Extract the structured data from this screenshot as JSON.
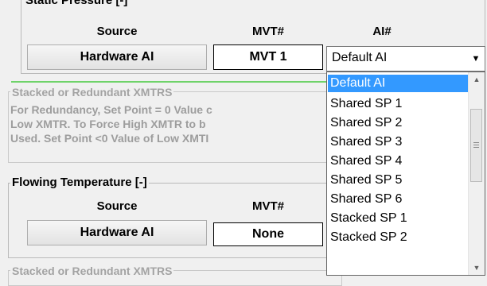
{
  "static_pressure": {
    "group_label": "Static Pressure [-]",
    "headers": {
      "source": "Source",
      "mvt": "MVT#",
      "ai": "AI#"
    },
    "source_button": "Hardware AI",
    "mvt_value": "MVT 1",
    "ai_value": "Default AI"
  },
  "stacked_1": {
    "group_label": "Stacked or Redundant XMTRS",
    "lines": [
      "For Redundancy, Set Point = 0 Value c",
      "Low XMTR.  To Force High XMTR to b",
      "Used. Set Point <0 Value of Low XMTI"
    ]
  },
  "flowing_temperature": {
    "group_label": "Flowing Temperature [-]",
    "headers": {
      "source": "Source",
      "mvt": "MVT#"
    },
    "source_button": "Hardware AI",
    "mvt_value": "None"
  },
  "stacked_2": {
    "group_label": "Stacked or Redundant XMTRS"
  },
  "ai_dropdown": {
    "options": [
      "Default AI",
      "Shared SP 1",
      "Shared SP 2",
      "Shared SP 3",
      "Shared SP 4",
      "Shared SP 5",
      "Shared SP 6",
      "Stacked SP 1",
      "Stacked SP 2"
    ],
    "selected_index": 0,
    "highlight_color": "#3399ff",
    "accent_line_color": "#6fd36a"
  }
}
